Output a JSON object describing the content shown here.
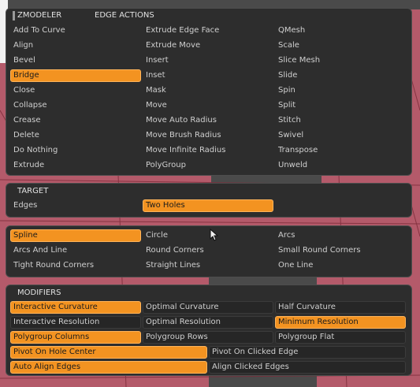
{
  "header": {
    "title": "ZMODELER",
    "subtitle": "EDGE ACTIONS"
  },
  "actions": {
    "col1": [
      "Add To Curve",
      "Align",
      "Bevel",
      "Bridge",
      "Close",
      "Collapse",
      "Crease",
      "Delete",
      "Do Nothing",
      "Extrude"
    ],
    "col2": [
      "Extrude Edge Face",
      "Extrude Move",
      "Insert",
      "Inset",
      "Mask",
      "Move",
      "Move Auto Radius",
      "Move Brush Radius",
      "Move Infinite Radius",
      "PolyGroup"
    ],
    "col3": [
      "QMesh",
      "Scale",
      "Slice Mesh",
      "Slide",
      "Spin",
      "Split",
      "Stitch",
      "Swivel",
      "Transpose",
      "Unweld"
    ],
    "selected": "Bridge"
  },
  "target": {
    "title": "TARGET",
    "items": [
      "Edges",
      "Two Holes"
    ],
    "selected": "Two Holes"
  },
  "shape": {
    "rows": [
      [
        "Spline",
        "Circle",
        "Arcs"
      ],
      [
        "Arcs And Line",
        "Round Corners",
        "Small Round Corners"
      ],
      [
        "Tight Round Corners",
        "Straight Lines",
        "One Line"
      ]
    ],
    "selected": "Spline"
  },
  "modifiers": {
    "title": "MODIFIERS",
    "rows3": [
      [
        "Interactive Curvature",
        "Optimal Curvature",
        "Half Curvature"
      ],
      [
        "Interactive Resolution",
        "Optimal Resolution",
        "Minimum Resolution"
      ],
      [
        "Polygroup Columns",
        "Polygroup Rows",
        "Polygroup Flat"
      ]
    ],
    "rows2": [
      [
        "Pivot On Hole Center",
        "Pivot On Clicked Edge"
      ],
      [
        "Auto Align Edges",
        "Align Clicked Edges"
      ]
    ],
    "selected": [
      "Interactive Curvature",
      "Minimum Resolution",
      "Polygroup Columns",
      "Pivot On Hole Center",
      "Auto Align Edges"
    ]
  },
  "colors": {
    "accent": "#f39321",
    "panel": "#2d2d2d",
    "mesh": "#b45a6a"
  }
}
